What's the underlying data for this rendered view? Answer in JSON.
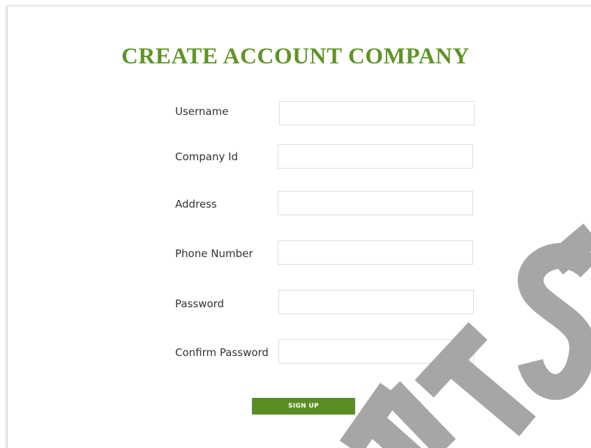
{
  "page": {
    "title": "CREATE ACCOUNT COMPANY"
  },
  "form": {
    "fields": [
      {
        "label": "Username",
        "value": "",
        "placeholder": ""
      },
      {
        "label": "Company Id",
        "value": "",
        "placeholder": ""
      },
      {
        "label": "Address",
        "value": "",
        "placeholder": ""
      },
      {
        "label": "Phone Number",
        "value": "",
        "placeholder": ""
      },
      {
        "label": "Password",
        "value": "",
        "placeholder": ""
      },
      {
        "label": "Confirm Password",
        "value": "",
        "placeholder": ""
      }
    ],
    "submit_label": "SIGN UP"
  },
  "colors": {
    "title": "#5f9426",
    "button": "#5a8e25",
    "watermark": "#a6a6a6"
  },
  "watermark": {
    "text": "ETSM"
  }
}
